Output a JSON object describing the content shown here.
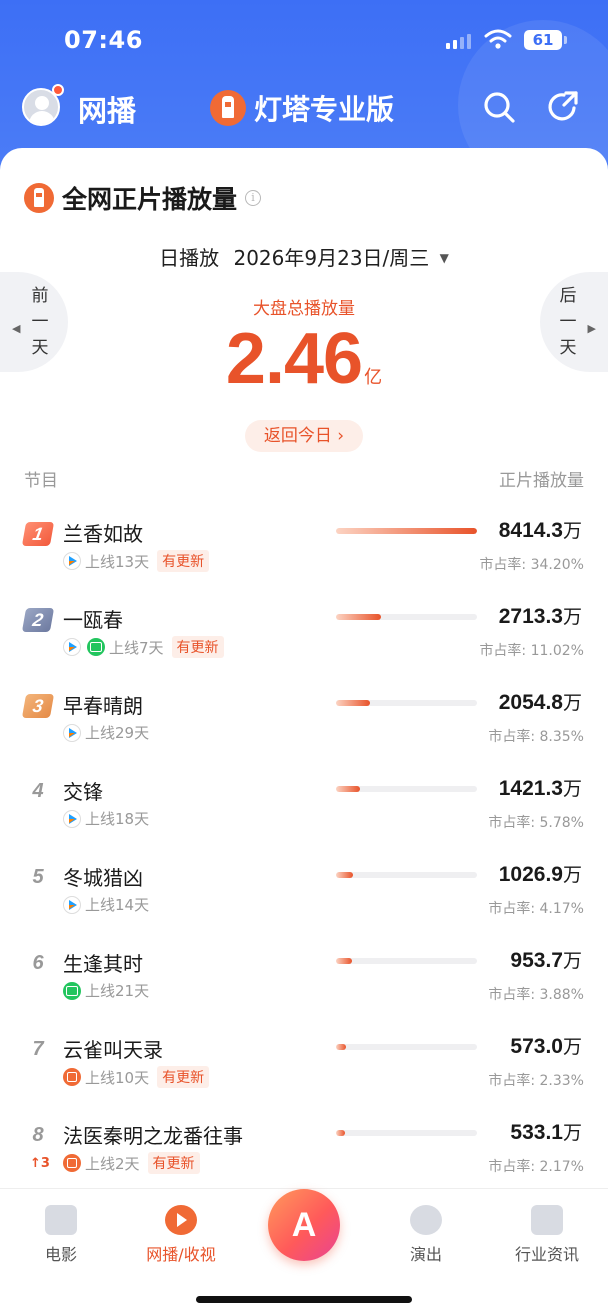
{
  "status": {
    "time": "07:46",
    "battery": "61"
  },
  "nav": {
    "title": "网播",
    "brand": "灯塔专业版"
  },
  "section": {
    "title": "全网正片播放量"
  },
  "date": {
    "mode": "日播放",
    "value": "2026年9月23日/周三"
  },
  "prev_day": [
    "前",
    "一",
    "天"
  ],
  "next_day": [
    "后",
    "一",
    "天"
  ],
  "total": {
    "label": "大盘总播放量",
    "value": "2.46",
    "unit": "亿"
  },
  "today_button": "返回今日 ›",
  "columns": {
    "left": "节目",
    "right": "正片播放量"
  },
  "rows": [
    {
      "rank": "1",
      "name": "兰香如故",
      "platforms": [
        "tencent"
      ],
      "online": "上线13天",
      "tag": "有更新",
      "value": "8414.3",
      "unit": "万",
      "share_label": "市占率: 34.20%",
      "share": 34.2
    },
    {
      "rank": "2",
      "name": "一瓯春",
      "platforms": [
        "tencent",
        "iqiyi"
      ],
      "online": "上线7天",
      "tag": "有更新",
      "value": "2713.3",
      "unit": "万",
      "share_label": "市占率: 11.02%",
      "share": 11.02
    },
    {
      "rank": "3",
      "name": "早春晴朗",
      "platforms": [
        "tencent"
      ],
      "online": "上线29天",
      "tag": "",
      "value": "2054.8",
      "unit": "万",
      "share_label": "市占率: 8.35%",
      "share": 8.35
    },
    {
      "rank": "4",
      "name": "交锋",
      "platforms": [
        "tencent"
      ],
      "online": "上线18天",
      "tag": "",
      "value": "1421.3",
      "unit": "万",
      "share_label": "市占率: 5.78%",
      "share": 5.78
    },
    {
      "rank": "5",
      "name": "冬城猎凶",
      "platforms": [
        "tencent"
      ],
      "online": "上线14天",
      "tag": "",
      "value": "1026.9",
      "unit": "万",
      "share_label": "市占率: 4.17%",
      "share": 4.17
    },
    {
      "rank": "6",
      "name": "生逢其时",
      "platforms": [
        "iqiyi"
      ],
      "online": "上线21天",
      "tag": "",
      "value": "953.7",
      "unit": "万",
      "share_label": "市占率: 3.88%",
      "share": 3.88
    },
    {
      "rank": "7",
      "name": "云雀叫天录",
      "platforms": [
        "mango"
      ],
      "online": "上线10天",
      "tag": "有更新",
      "value": "573.0",
      "unit": "万",
      "share_label": "市占率: 2.33%",
      "share": 2.33
    },
    {
      "rank": "8",
      "rank_change": "↑3",
      "name": "法医秦明之龙番往事",
      "platforms": [
        "mango"
      ],
      "online": "上线2天",
      "tag": "有更新",
      "value": "533.1",
      "unit": "万",
      "share_label": "市占率: 2.17%",
      "share": 2.17
    }
  ],
  "tabs": [
    {
      "label": "电影",
      "icon": "film-icon",
      "active": false
    },
    {
      "label": "网播/收视",
      "icon": "play-icon",
      "active": true
    },
    {
      "label": "A",
      "icon": "lighthouse-ai-icon",
      "center": true
    },
    {
      "label": "演出",
      "icon": "microphone-icon",
      "active": false
    },
    {
      "label": "行业资讯",
      "icon": "news-icon",
      "active": false
    }
  ],
  "colors": {
    "accent": "#e8532a",
    "header_blue": "#3d6ff5"
  }
}
